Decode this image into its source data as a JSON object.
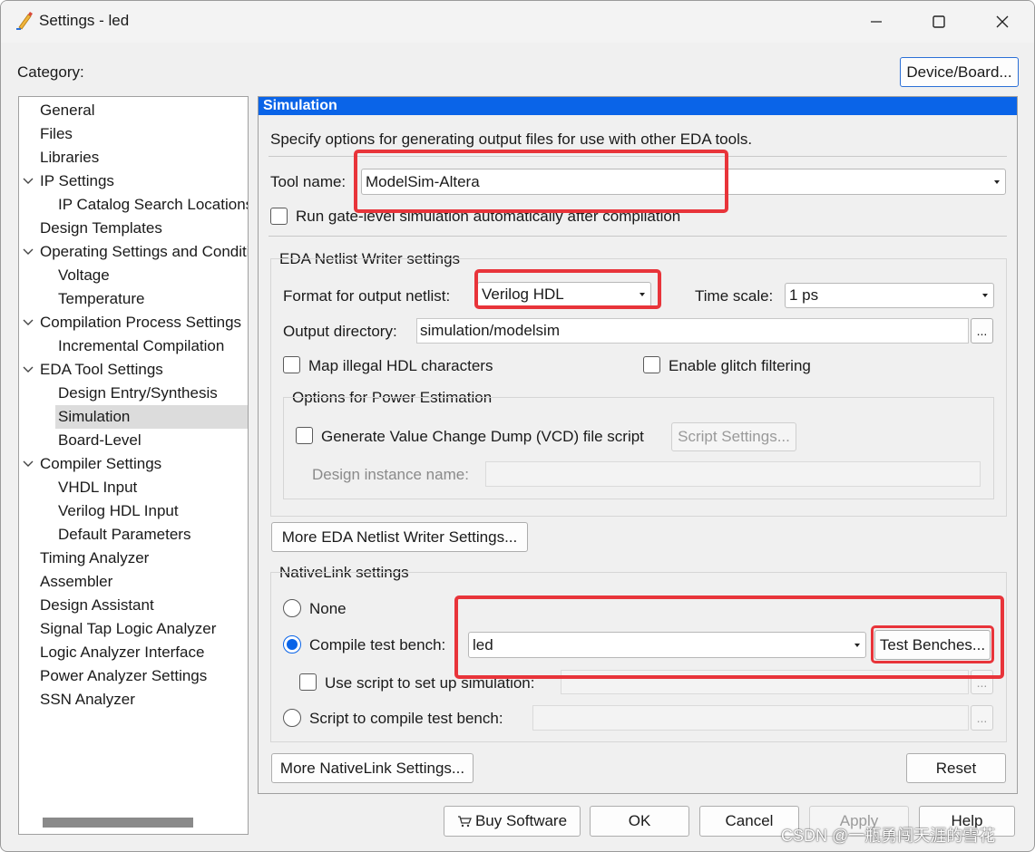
{
  "window": {
    "title": "Settings - led",
    "controls": {
      "minimize_icon": "minimize-icon",
      "maximize_icon": "maximize-icon",
      "close_icon": "close-icon"
    }
  },
  "category_label": "Category:",
  "device_board_button": "Device/Board...",
  "tree": {
    "items": [
      {
        "label": "General",
        "indent": 0,
        "expanded": null
      },
      {
        "label": "Files",
        "indent": 0,
        "expanded": null
      },
      {
        "label": "Libraries",
        "indent": 0,
        "expanded": null
      },
      {
        "label": "IP Settings",
        "indent": 0,
        "expanded": true
      },
      {
        "label": "IP Catalog Search Locations",
        "indent": 1,
        "expanded": null
      },
      {
        "label": "Design Templates",
        "indent": 0,
        "expanded": null
      },
      {
        "label": "Operating Settings and Conditions",
        "indent": 0,
        "expanded": true
      },
      {
        "label": "Voltage",
        "indent": 1,
        "expanded": null
      },
      {
        "label": "Temperature",
        "indent": 1,
        "expanded": null
      },
      {
        "label": "Compilation Process Settings",
        "indent": 0,
        "expanded": true
      },
      {
        "label": "Incremental Compilation",
        "indent": 1,
        "expanded": null
      },
      {
        "label": "EDA Tool Settings",
        "indent": 0,
        "expanded": true
      },
      {
        "label": "Design Entry/Synthesis",
        "indent": 1,
        "expanded": null
      },
      {
        "label": "Simulation",
        "indent": 1,
        "expanded": null,
        "selected": true
      },
      {
        "label": "Board-Level",
        "indent": 1,
        "expanded": null
      },
      {
        "label": "Compiler Settings",
        "indent": 0,
        "expanded": true
      },
      {
        "label": "VHDL Input",
        "indent": 1,
        "expanded": null
      },
      {
        "label": "Verilog HDL Input",
        "indent": 1,
        "expanded": null
      },
      {
        "label": "Default Parameters",
        "indent": 1,
        "expanded": null
      },
      {
        "label": "Timing Analyzer",
        "indent": 0,
        "expanded": null
      },
      {
        "label": "Assembler",
        "indent": 0,
        "expanded": null
      },
      {
        "label": "Design Assistant",
        "indent": 0,
        "expanded": null
      },
      {
        "label": "Signal Tap Logic Analyzer",
        "indent": 0,
        "expanded": null
      },
      {
        "label": "Logic Analyzer Interface",
        "indent": 0,
        "expanded": null
      },
      {
        "label": "Power Analyzer Settings",
        "indent": 0,
        "expanded": null
      },
      {
        "label": "SSN Analyzer",
        "indent": 0,
        "expanded": null
      }
    ]
  },
  "panel": {
    "header": "Simulation",
    "description": "Specify options for generating output files for use with other EDA tools.",
    "tool_name_label": "Tool name:",
    "tool_name_value": "ModelSim-Altera",
    "run_gate_level_label": "Run gate-level simulation automatically after compilation",
    "run_gate_level_checked": false,
    "eda_netlist": {
      "group_title": "EDA Netlist Writer settings",
      "format_label": "Format for output netlist:",
      "format_value": "Verilog HDL",
      "time_scale_label": "Time scale:",
      "time_scale_value": "1 ps",
      "output_dir_label": "Output directory:",
      "output_dir_value": "simulation/modelsim",
      "browse_label": "...",
      "map_illegal_label": "Map illegal HDL characters",
      "map_illegal_checked": false,
      "glitch_label": "Enable glitch filtering",
      "glitch_checked": false,
      "power": {
        "group_title": "Options for Power Estimation",
        "vcd_label": "Generate Value Change Dump (VCD) file script",
        "vcd_checked": false,
        "script_settings_button": "Script Settings...",
        "design_instance_label": "Design instance name:",
        "design_instance_value": ""
      }
    },
    "more_eda_button": "More EDA Netlist Writer Settings...",
    "nativelink": {
      "group_title": "NativeLink settings",
      "none_label": "None",
      "compile_tb_label": "Compile test bench:",
      "compile_tb_value": "led",
      "test_benches_button": "Test Benches...",
      "use_script_label": "Use script to set up simulation:",
      "use_script_value": "",
      "use_script_browse": "...",
      "script_compile_label": "Script to compile test bench:",
      "script_compile_value": "",
      "script_compile_browse": "...",
      "selected_option": "compile_test_bench"
    },
    "more_nativelink_button": "More NativeLink Settings...",
    "reset_button": "Reset"
  },
  "footer": {
    "buy_software": "Buy Software",
    "ok": "OK",
    "cancel": "Cancel",
    "apply": "Apply",
    "help": "Help"
  },
  "watermark": "CSDN @一瓶勇闯天涯的雪花",
  "colors": {
    "accent": "#0a64e8",
    "highlight": "#e8343a"
  }
}
